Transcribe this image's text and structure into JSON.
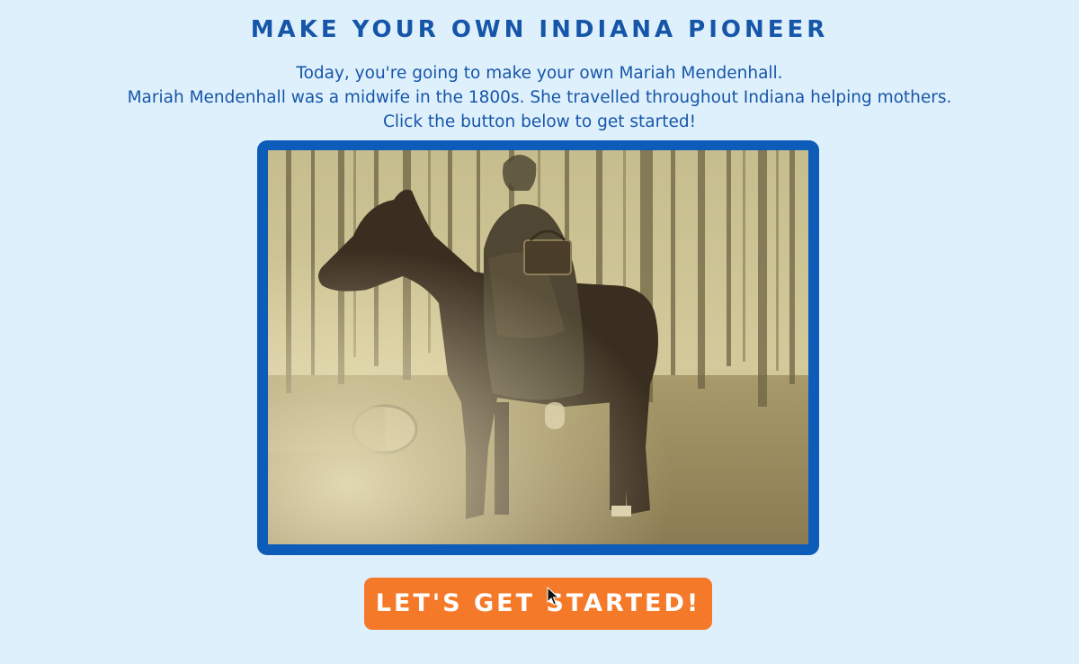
{
  "page": {
    "title": "MAKE YOUR OWN INDIANA PIONEER",
    "intro_lines": [
      "Today, you're going to make your own Mariah Mendenhall.",
      "Mariah Mendenhall was a midwife in the 1800s. She travelled throughout Indiana helping mothers.",
      "Click the button below to get started!"
    ]
  },
  "photo": {
    "subject": "Mariah Mendenhall on horseback in a forest"
  },
  "cta": {
    "label": "LET'S GET STARTED!"
  },
  "colors": {
    "background": "#dff0fd",
    "heading": "#1656a8",
    "frame": "#0d5cba",
    "button": "#f47a2a",
    "button_text": "#ffffff"
  },
  "icons": {
    "pointer": "mouse-pointer-icon"
  }
}
